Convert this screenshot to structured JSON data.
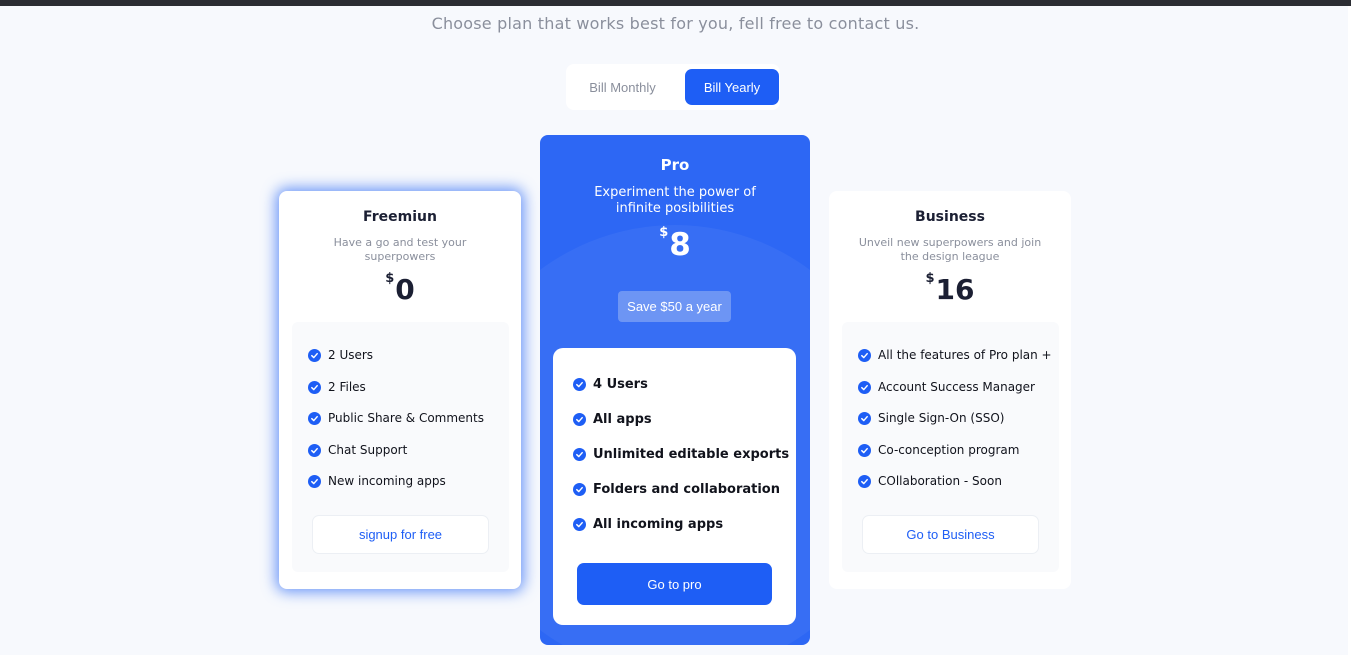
{
  "header": {
    "subtitle": "Choose plan that works best for you, fell free to contact us."
  },
  "billing_toggle": {
    "monthly_label": "Bill Monthly",
    "yearly_label": "Bill Yearly",
    "selected": "yearly"
  },
  "plans": {
    "free": {
      "name": "Freemiun",
      "description": "Have a go and test your superpowers",
      "currency": "$",
      "price": "0",
      "features": [
        "2 Users",
        "2 Files",
        "Public Share & Comments",
        "Chat Support",
        "New incoming apps"
      ],
      "cta": "signup for free"
    },
    "pro": {
      "name": "Pro",
      "description": "Experiment the power of infinite posibilities",
      "currency": "$",
      "price": "8",
      "save_badge": "Save $50 a year",
      "features": [
        "4 Users",
        "All apps",
        "Unlimited editable exports",
        "Folders and collaboration",
        "All incoming apps"
      ],
      "cta": "Go to pro"
    },
    "business": {
      "name": "Business",
      "description": "Unveil new superpowers and join the design league",
      "currency": "$",
      "price": "16",
      "features": [
        "All the features of Pro plan +",
        "Account Success Manager",
        "Single Sign-On (SSO)",
        "Co-conception program",
        "COllaboration - Soon"
      ],
      "cta": "Go to Business"
    }
  },
  "colors": {
    "accent": "#1e5ef5",
    "pro_card": "#2d67f4",
    "background": "#f7f9fd",
    "muted_text": "#8a8f9c"
  }
}
